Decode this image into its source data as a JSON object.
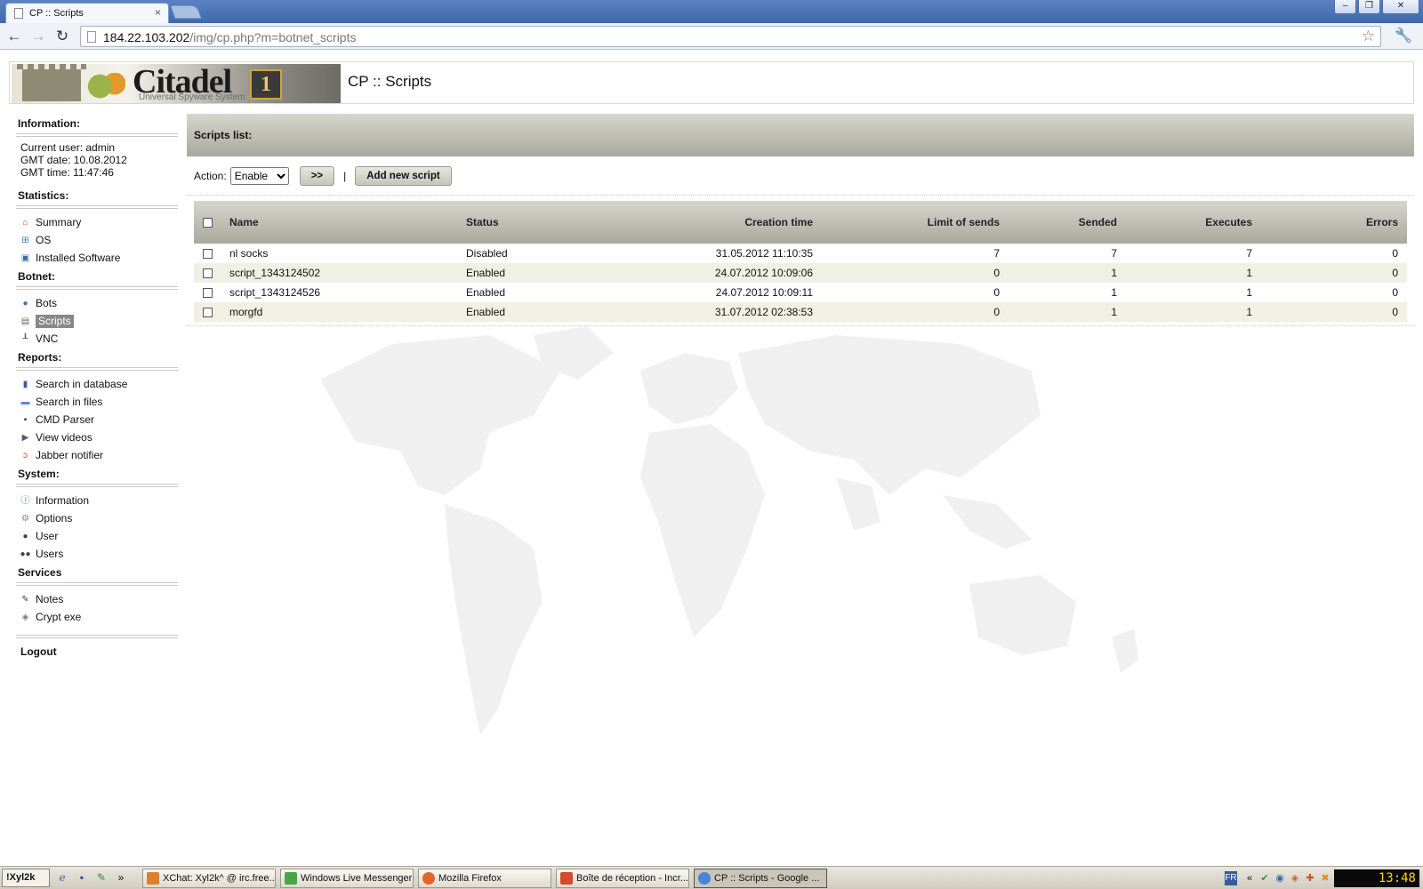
{
  "browser": {
    "tab_title": "CP :: Scripts",
    "tab_close": "×",
    "url_host": "184.22.103.202",
    "url_path": "/img/cp.php?m=botnet_scripts",
    "window_buttons": [
      "–",
      "❐",
      "✕"
    ]
  },
  "header": {
    "logo_text": "Citadel",
    "logo_badge": "1",
    "logo_tagline": "Universal Spyware System",
    "page_title": "CP :: Scripts"
  },
  "sidebar": {
    "information_title": "Information:",
    "info_lines": [
      "Current user: admin",
      "GMT date: 10.08.2012",
      "GMT time: 11:47:46"
    ],
    "statistics_title": "Statistics:",
    "statistics_items": [
      {
        "label": "Summary",
        "icon": "home-icon"
      },
      {
        "label": "OS",
        "icon": "windows-icon"
      },
      {
        "label": "Installed Software",
        "icon": "software-icon"
      }
    ],
    "botnet_title": "Botnet:",
    "botnet_items": [
      {
        "label": "Bots",
        "icon": "globe-icon"
      },
      {
        "label": "Scripts",
        "icon": "clipboard-icon"
      },
      {
        "label": "VNC",
        "icon": "joystick-icon"
      }
    ],
    "reports_title": "Reports:",
    "reports_items": [
      {
        "label": "Search in database",
        "icon": "book-icon"
      },
      {
        "label": "Search in files",
        "icon": "folder-icon"
      },
      {
        "label": "CMD Parser",
        "icon": "terminal-icon"
      },
      {
        "label": "View videos",
        "icon": "video-icon"
      },
      {
        "label": "Jabber notifier",
        "icon": "jabber-icon"
      }
    ],
    "system_title": "System:",
    "system_items": [
      {
        "label": "Information",
        "icon": "info-icon"
      },
      {
        "label": "Options",
        "icon": "gear-icon"
      },
      {
        "label": "User",
        "icon": "user-icon"
      },
      {
        "label": "Users",
        "icon": "users-icon"
      }
    ],
    "services_title": "Services",
    "services_items": [
      {
        "label": "Notes",
        "icon": "pen-icon"
      },
      {
        "label": "Crypt exe",
        "icon": "shield-icon"
      }
    ],
    "logout": "Logout"
  },
  "content": {
    "box_title": "Scripts list:",
    "action_label": "Action:",
    "action_selected": "Enable",
    "go_button": ">>",
    "separator": "|",
    "add_button": "Add new script",
    "columns": [
      "Name",
      "Status",
      "Creation time",
      "Limit of sends",
      "Sended",
      "Executes",
      "Errors"
    ],
    "rows": [
      {
        "name": "nl socks",
        "status": "Disabled",
        "created": "31.05.2012 11:10:35",
        "limit": "7",
        "sended": "7",
        "executes": "7",
        "errors": "0"
      },
      {
        "name": "script_1343124502",
        "status": "Enabled",
        "created": "24.07.2012 10:09:06",
        "limit": "0",
        "sended": "1",
        "executes": "1",
        "errors": "0"
      },
      {
        "name": "script_1343124526",
        "status": "Enabled",
        "created": "24.07.2012 10:09:11",
        "limit": "0",
        "sended": "1",
        "executes": "1",
        "errors": "0"
      },
      {
        "name": "morgfd",
        "status": "Enabled",
        "created": "31.07.2012 02:38:53",
        "limit": "0",
        "sended": "1",
        "executes": "1",
        "errors": "0"
      }
    ]
  },
  "taskbar": {
    "start_label": "!Xyl2k",
    "more": "»",
    "tasks": [
      {
        "label": "XChat: Xyl2k^ @ irc.free...",
        "color": "#d9822b"
      },
      {
        "label": "Windows Live Messenger",
        "color": "#4aa54a"
      },
      {
        "label": "Mozilla Firefox",
        "color": "#e0662b"
      },
      {
        "label": "Boîte de réception - Incr...",
        "color": "#d34b2a"
      },
      {
        "label": "CP :: Scripts - Google ...",
        "color": "#4a86d8"
      }
    ],
    "language": "FR",
    "tray_chevron": "«",
    "clock": "13:48"
  }
}
